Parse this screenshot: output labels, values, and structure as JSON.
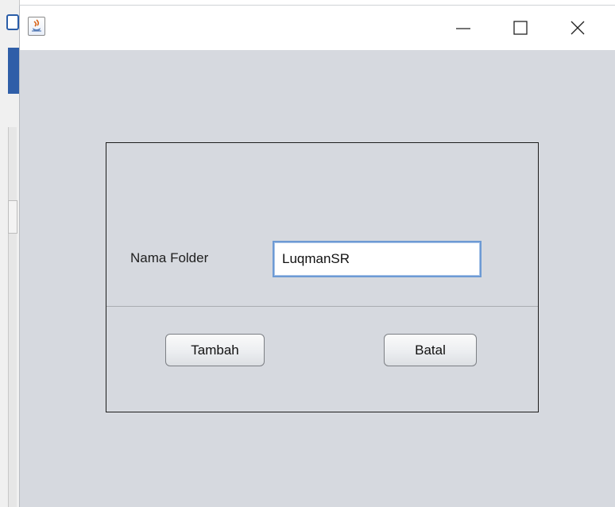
{
  "window": {
    "title": "",
    "icon": "java-cup-icon",
    "controls": [
      "minimize-icon",
      "maximize-icon",
      "close-icon"
    ]
  },
  "form": {
    "folder_label": "Nama Folder",
    "folder_value": "LuqmanSR",
    "add_button": "Tambah",
    "cancel_button": "Batal"
  },
  "colors": {
    "window_background": "#d6d9df",
    "input_focus_border": "#6d9ad4"
  }
}
